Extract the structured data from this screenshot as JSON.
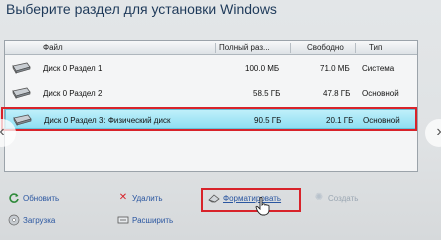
{
  "heading": "Выберите раздел для установки Windows",
  "table": {
    "columns": [
      "Файл",
      "Полный раз...",
      "Свободно",
      "Тип"
    ],
    "rows": [
      {
        "name": "Диск 0 Раздел 1",
        "size": "100.0 МБ",
        "free": "71.0 МБ",
        "type": "Система"
      },
      {
        "name": "Диск 0 Раздел 2",
        "size": "58.5 ГБ",
        "free": "47.8 ГБ",
        "type": "Основной"
      },
      {
        "name": "Диск 0 Раздел 3: Физический диск",
        "size": "90.5 ГБ",
        "free": "20.1 ГБ",
        "type": "Основной"
      }
    ]
  },
  "actions": {
    "refresh": "Обновить",
    "delete": "Удалить",
    "format": "Форматировать",
    "create": "Создать",
    "load": "Загрузка",
    "extend": "Расширить"
  },
  "nav": {
    "prev_icon": "chevron-left-icon",
    "next_icon": "chevron-right-icon"
  },
  "colors": {
    "highlight": "#d8232a",
    "selected_row": "#8fdff2",
    "link": "#2a56a0"
  }
}
